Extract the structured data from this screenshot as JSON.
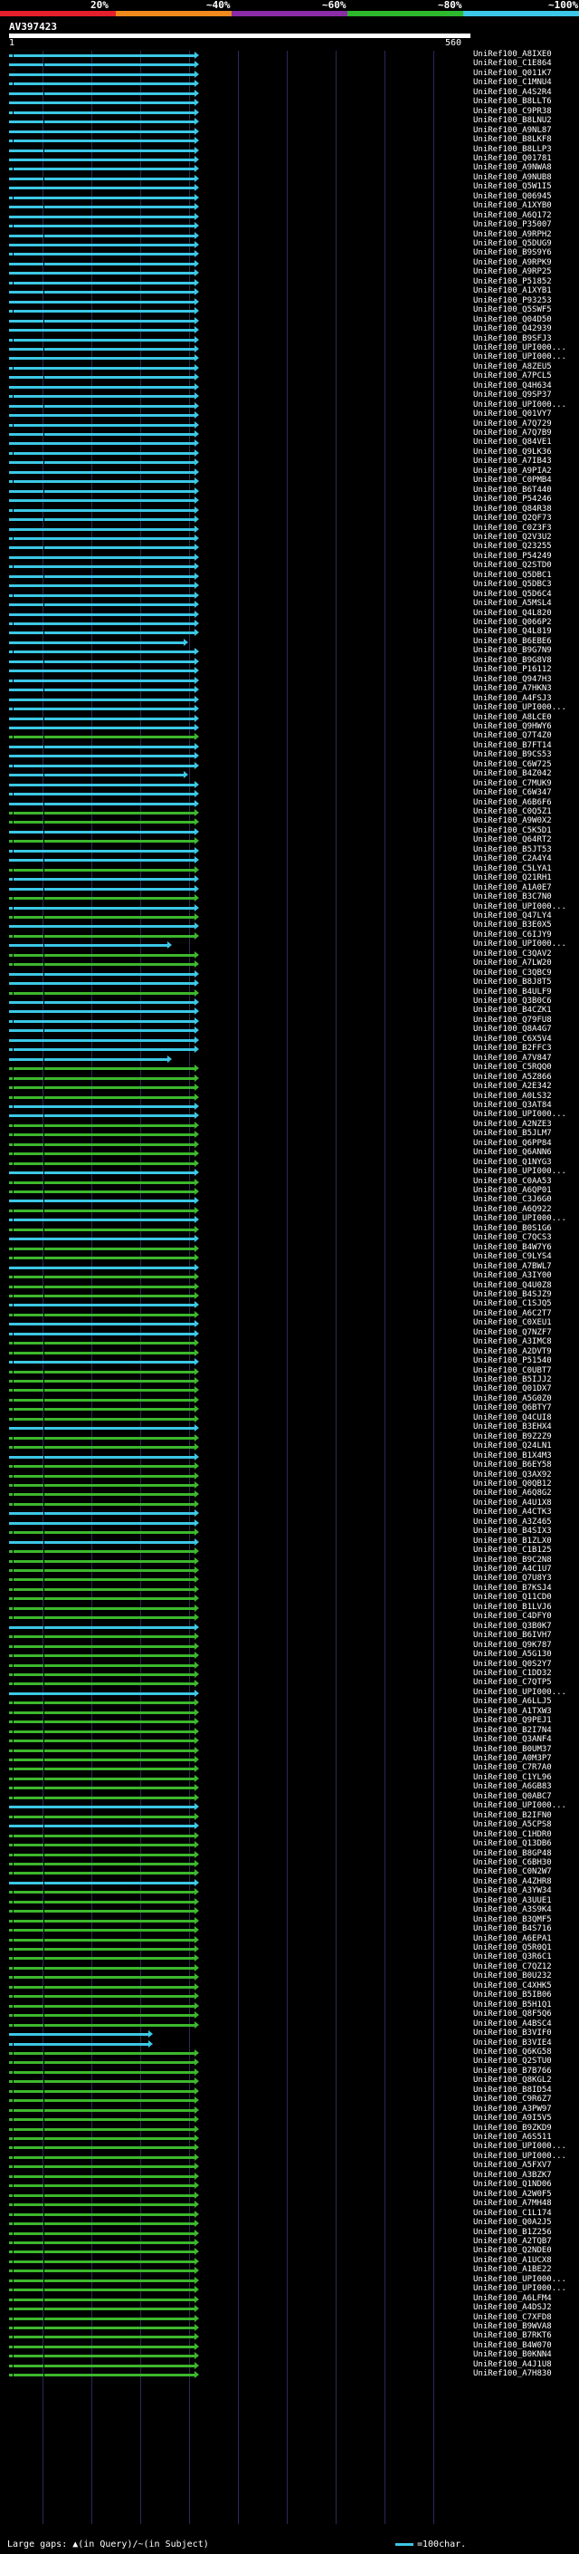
{
  "scale": {
    "ticks": [
      "20%",
      "~40%",
      "~60%",
      "~80%",
      "~100%"
    ],
    "colors": [
      "#e6202a",
      "#f08a1c",
      "#8a2ca6",
      "#2db82d",
      "#3cc8e6"
    ]
  },
  "query": {
    "name": "AV397423",
    "start": "1",
    "end": "560"
  },
  "hit_colors": {
    "cyan": "#3cc8e6",
    "green": "#3db82d",
    "gap": "#000000"
  },
  "hits": [
    {
      "label": "UniRef100_A8IXE0",
      "color": "cyan"
    },
    {
      "label": "UniRef100_C1E864",
      "color": "cyan"
    },
    {
      "label": "UniRef100_Q011K7",
      "color": "cyan"
    },
    {
      "label": "UniRef100_C1MNU4",
      "color": "cyan"
    },
    {
      "label": "UniRef100_A4S2R4",
      "color": "cyan"
    },
    {
      "label": "UniRef100_B8LLT6",
      "color": "cyan"
    },
    {
      "label": "UniRef100_C9PR38",
      "color": "cyan"
    },
    {
      "label": "UniRef100_B8LNU2",
      "color": "cyan"
    },
    {
      "label": "UniRef100_A9NL87",
      "color": "cyan"
    },
    {
      "label": "UniRef100_B8LKF8",
      "color": "cyan"
    },
    {
      "label": "UniRef100_B8LLP3",
      "color": "cyan"
    },
    {
      "label": "UniRef100_Q01781",
      "color": "cyan"
    },
    {
      "label": "UniRef100_A9NWA8",
      "color": "cyan"
    },
    {
      "label": "UniRef100_A9NUB8",
      "color": "cyan"
    },
    {
      "label": "UniRef100_Q5W1I5",
      "color": "cyan"
    },
    {
      "label": "UniRef100_Q06945",
      "color": "cyan"
    },
    {
      "label": "UniRef100_A1XYB0",
      "color": "cyan"
    },
    {
      "label": "UniRef100_A6Q172",
      "color": "cyan"
    },
    {
      "label": "UniRef100_P35007",
      "color": "cyan"
    },
    {
      "label": "UniRef100_A9RPH2",
      "color": "cyan"
    },
    {
      "label": "UniRef100_Q5DUG9",
      "color": "cyan"
    },
    {
      "label": "UniRef100_B9S9Y6",
      "color": "cyan"
    },
    {
      "label": "UniRef100_A9RPK9",
      "color": "cyan"
    },
    {
      "label": "UniRef100_A9RP25",
      "color": "cyan"
    },
    {
      "label": "UniRef100_P51852",
      "color": "cyan"
    },
    {
      "label": "UniRef100_A1XYB1",
      "color": "cyan"
    },
    {
      "label": "UniRef100_P93253",
      "color": "cyan"
    },
    {
      "label": "UniRef100_Q5SWF5",
      "color": "cyan"
    },
    {
      "label": "UniRef100_Q04D50",
      "color": "cyan"
    },
    {
      "label": "UniRef100_Q42939",
      "color": "cyan"
    },
    {
      "label": "UniRef100_B9SFJ3",
      "color": "cyan"
    },
    {
      "label": "UniRef100_UPI000...",
      "color": "cyan"
    },
    {
      "label": "UniRef100_UPI000...",
      "color": "cyan"
    },
    {
      "label": "UniRef100_A8ZEU5",
      "color": "cyan"
    },
    {
      "label": "UniRef100_A7PCL5",
      "color": "cyan"
    },
    {
      "label": "UniRef100_Q4H634",
      "color": "cyan"
    },
    {
      "label": "UniRef100_Q9SP37",
      "color": "cyan"
    },
    {
      "label": "UniRef100_UPI000...",
      "color": "cyan"
    },
    {
      "label": "UniRef100_Q01VY7",
      "color": "cyan"
    },
    {
      "label": "UniRef100_A7Q729",
      "color": "cyan"
    },
    {
      "label": "UniRef100_A7Q7B9",
      "color": "cyan"
    },
    {
      "label": "UniRef100_Q84VE1",
      "color": "cyan"
    },
    {
      "label": "UniRef100_Q9LK36",
      "color": "cyan"
    },
    {
      "label": "UniRef100_A7IB43",
      "color": "cyan"
    },
    {
      "label": "UniRef100_A9PIA2",
      "color": "cyan"
    },
    {
      "label": "UniRef100_C0PMB4",
      "color": "cyan"
    },
    {
      "label": "UniRef100_B6T440",
      "color": "cyan"
    },
    {
      "label": "UniRef100_P54246",
      "color": "cyan"
    },
    {
      "label": "UniRef100_Q84R38",
      "color": "cyan"
    },
    {
      "label": "UniRef100_Q2QF73",
      "color": "cyan"
    },
    {
      "label": "UniRef100_C0Z3F3",
      "color": "cyan"
    },
    {
      "label": "UniRef100_Q2V3U2",
      "color": "cyan"
    },
    {
      "label": "UniRef100_Q23255",
      "color": "cyan"
    },
    {
      "label": "UniRef100_P54249",
      "color": "cyan"
    },
    {
      "label": "UniRef100_Q2STD0",
      "color": "cyan"
    },
    {
      "label": "UniRef100_Q5DBC1",
      "color": "cyan"
    },
    {
      "label": "UniRef100_Q5DBC3",
      "color": "cyan"
    },
    {
      "label": "UniRef100_Q5D6C4",
      "color": "cyan"
    },
    {
      "label": "UniRef100_A5MSL4",
      "color": "cyan"
    },
    {
      "label": "UniRef100_Q4L820",
      "color": "cyan"
    },
    {
      "label": "UniRef100_Q066P2",
      "color": "cyan"
    },
    {
      "label": "UniRef100_Q4L819",
      "color": "cyan"
    },
    {
      "label": "UniRef100_B6EBE6",
      "color": "cyan",
      "short": true
    },
    {
      "label": "UniRef100_B9G7N9",
      "color": "cyan"
    },
    {
      "label": "UniRef100_B9G8V8",
      "color": "cyan"
    },
    {
      "label": "UniRef100_P16112",
      "color": "cyan"
    },
    {
      "label": "UniRef100_Q947H3",
      "color": "cyan"
    },
    {
      "label": "UniRef100_A7HKN3",
      "color": "cyan"
    },
    {
      "label": "UniRef100_A4FSJ3",
      "color": "cyan"
    },
    {
      "label": "UniRef100_UPI000...",
      "color": "cyan"
    },
    {
      "label": "UniRef100_A8LCE0",
      "color": "cyan"
    },
    {
      "label": "UniRef100_Q9HWY6",
      "color": "cyan"
    },
    {
      "label": "UniRef100_Q7T4Z0",
      "color": "green"
    },
    {
      "label": "UniRef100_B7FT14",
      "color": "cyan"
    },
    {
      "label": "UniRef100_B9CS53",
      "color": "cyan"
    },
    {
      "label": "UniRef100_C6W725",
      "color": "cyan"
    },
    {
      "label": "UniRef100_B4Z042",
      "color": "cyan",
      "short": true
    },
    {
      "label": "UniRef100_C7MUK9",
      "color": "cyan"
    },
    {
      "label": "UniRef100_C6W347",
      "color": "cyan"
    },
    {
      "label": "UniRef100_A6B6F6",
      "color": "cyan"
    },
    {
      "label": "UniRef100_C0Q5Z1",
      "color": "green"
    },
    {
      "label": "UniRef100_A9W0X2",
      "color": "green"
    },
    {
      "label": "UniRef100_C5K5D1",
      "color": "cyan"
    },
    {
      "label": "UniRef100_Q64RT2",
      "color": "green"
    },
    {
      "label": "UniRef100_B5JT53",
      "color": "cyan"
    },
    {
      "label": "UniRef100_C2A4Y4",
      "color": "cyan"
    },
    {
      "label": "UniRef100_C5LYA1",
      "color": "green"
    },
    {
      "label": "UniRef100_Q21RH1",
      "color": "cyan"
    },
    {
      "label": "UniRef100_A1A0E7",
      "color": "cyan"
    },
    {
      "label": "UniRef100_B3C7N0",
      "color": "green"
    },
    {
      "label": "UniRef100_UPI000...",
      "color": "cyan"
    },
    {
      "label": "UniRef100_Q47LY4",
      "color": "green"
    },
    {
      "label": "UniRef100_B3E0X5",
      "color": "cyan"
    },
    {
      "label": "UniRef100_C6IJY9",
      "color": "green"
    },
    {
      "label": "UniRef100_UPI000...",
      "color": "cyan",
      "short2": true
    },
    {
      "label": "UniRef100_C3QAV2",
      "color": "green"
    },
    {
      "label": "UniRef100_A7LW20",
      "color": "green"
    },
    {
      "label": "UniRef100_C3QBC9",
      "color": "cyan"
    },
    {
      "label": "UniRef100_B8J8T5",
      "color": "cyan"
    },
    {
      "label": "UniRef100_B4ULF9",
      "color": "green"
    },
    {
      "label": "UniRef100_Q3B0C6",
      "color": "cyan"
    },
    {
      "label": "UniRef100_B4CZK1",
      "color": "cyan"
    },
    {
      "label": "UniRef100_Q79FU8",
      "color": "cyan"
    },
    {
      "label": "UniRef100_Q8A4G7",
      "color": "cyan"
    },
    {
      "label": "UniRef100_C6X5V4",
      "color": "cyan"
    },
    {
      "label": "UniRef100_B2FFC3",
      "color": "cyan"
    },
    {
      "label": "UniRef100_A7V847",
      "color": "cyan",
      "short2": true
    },
    {
      "label": "UniRef100_C5RQQ0",
      "color": "green"
    },
    {
      "label": "UniRef100_A5Z866",
      "color": "green"
    },
    {
      "label": "UniRef100_A2E342",
      "color": "green"
    },
    {
      "label": "UniRef100_A0LS32",
      "color": "green"
    },
    {
      "label": "UniRef100_Q3AT84",
      "color": "cyan"
    },
    {
      "label": "UniRef100_UPI000...",
      "color": "cyan"
    },
    {
      "label": "UniRef100_A2NZE3",
      "color": "green"
    },
    {
      "label": "UniRef100_B5JLM7",
      "color": "green"
    },
    {
      "label": "UniRef100_Q6PP84",
      "color": "green"
    },
    {
      "label": "UniRef100_Q6ANN6",
      "color": "green"
    },
    {
      "label": "UniRef100_Q1NYG3",
      "color": "green"
    },
    {
      "label": "UniRef100_UPI000...",
      "color": "cyan"
    },
    {
      "label": "UniRef100_C0AA53",
      "color": "green"
    },
    {
      "label": "UniRef100_A6QP01",
      "color": "green"
    },
    {
      "label": "UniRef100_C3J6G0",
      "color": "cyan"
    },
    {
      "label": "UniRef100_A6Q922",
      "color": "green"
    },
    {
      "label": "UniRef100_UPI000...",
      "color": "cyan"
    },
    {
      "label": "UniRef100_B0S1G6",
      "color": "green"
    },
    {
      "label": "UniRef100_C7QCS3",
      "color": "cyan"
    },
    {
      "label": "UniRef100_B4W7Y6",
      "color": "green"
    },
    {
      "label": "UniRef100_C9LYS4",
      "color": "green"
    },
    {
      "label": "UniRef100_A7BWL7",
      "color": "cyan"
    },
    {
      "label": "UniRef100_A3IY00",
      "color": "green"
    },
    {
      "label": "UniRef100_Q4U0Z8",
      "color": "green"
    },
    {
      "label": "UniRef100_B4SJZ9",
      "color": "green"
    },
    {
      "label": "UniRef100_C1SJQ5",
      "color": "cyan"
    },
    {
      "label": "UniRef100_A6C2T7",
      "color": "green"
    },
    {
      "label": "UniRef100_C0XEU1",
      "color": "cyan"
    },
    {
      "label": "UniRef100_Q7NZF7",
      "color": "cyan"
    },
    {
      "label": "UniRef100_A3IMC8",
      "color": "green"
    },
    {
      "label": "UniRef100_A2DVT9",
      "color": "green"
    },
    {
      "label": "UniRef100_P51540",
      "color": "cyan"
    },
    {
      "label": "UniRef100_C0UBT7",
      "color": "green"
    },
    {
      "label": "UniRef100_B5IJJ2",
      "color": "green"
    },
    {
      "label": "UniRef100_Q01DX7",
      "color": "green"
    },
    {
      "label": "UniRef100_A5G0Z0",
      "color": "green"
    },
    {
      "label": "UniRef100_Q6BTY7",
      "color": "green"
    },
    {
      "label": "UniRef100_Q4CUI8",
      "color": "green"
    },
    {
      "label": "UniRef100_B3EHX4",
      "color": "cyan"
    },
    {
      "label": "UniRef100_B9Z2Z9",
      "color": "green"
    },
    {
      "label": "UniRef100_Q24LN1",
      "color": "green"
    },
    {
      "label": "UniRef100_B1X4M3",
      "color": "cyan"
    },
    {
      "label": "UniRef100_B6EY58",
      "color": "green"
    },
    {
      "label": "UniRef100_Q3AX92",
      "color": "green"
    },
    {
      "label": "UniRef100_Q0QB12",
      "color": "green"
    },
    {
      "label": "UniRef100_A6Q8G2",
      "color": "green"
    },
    {
      "label": "UniRef100_A4U1X8",
      "color": "green"
    },
    {
      "label": "UniRef100_A4CTK3",
      "color": "cyan"
    },
    {
      "label": "UniRef100_A3Z465",
      "color": "cyan"
    },
    {
      "label": "UniRef100_B4SIX3",
      "color": "green"
    },
    {
      "label": "UniRef100_B1ZLX0",
      "color": "cyan"
    },
    {
      "label": "UniRef100_C1B125",
      "color": "green"
    },
    {
      "label": "UniRef100_B9C2N8",
      "color": "green"
    },
    {
      "label": "UniRef100_A4C1U7",
      "color": "green"
    },
    {
      "label": "UniRef100_Q7U8Y3",
      "color": "green"
    },
    {
      "label": "UniRef100_B7KSJ4",
      "color": "green"
    },
    {
      "label": "UniRef100_Q11CD0",
      "color": "green"
    },
    {
      "label": "UniRef100_B1LVJ6",
      "color": "green"
    },
    {
      "label": "UniRef100_C4DFY0",
      "color": "green"
    },
    {
      "label": "UniRef100_Q3B0K7",
      "color": "cyan"
    },
    {
      "label": "UniRef100_B6IVH7",
      "color": "green"
    },
    {
      "label": "UniRef100_Q9K787",
      "color": "green"
    },
    {
      "label": "UniRef100_A5G130",
      "color": "green"
    },
    {
      "label": "UniRef100_Q0S2Y7",
      "color": "green"
    },
    {
      "label": "UniRef100_C1DD32",
      "color": "green"
    },
    {
      "label": "UniRef100_C7QTP5",
      "color": "green"
    },
    {
      "label": "UniRef100_UPI000...",
      "color": "cyan"
    },
    {
      "label": "UniRef100_A6LLJ5",
      "color": "green"
    },
    {
      "label": "UniRef100_A1TXW3",
      "color": "green"
    },
    {
      "label": "UniRef100_Q9PEJ1",
      "color": "green"
    },
    {
      "label": "UniRef100_B2I7N4",
      "color": "green"
    },
    {
      "label": "UniRef100_Q3ANF4",
      "color": "green"
    },
    {
      "label": "UniRef100_B0UM37",
      "color": "green"
    },
    {
      "label": "UniRef100_A0M3P7",
      "color": "green"
    },
    {
      "label": "UniRef100_C7R7A0",
      "color": "green"
    },
    {
      "label": "UniRef100_C1YL96",
      "color": "green"
    },
    {
      "label": "UniRef100_A6GB83",
      "color": "green"
    },
    {
      "label": "UniRef100_Q0ABC7",
      "color": "green"
    },
    {
      "label": "UniRef100_UPI000...",
      "color": "cyan"
    },
    {
      "label": "UniRef100_B2IFN0",
      "color": "green"
    },
    {
      "label": "UniRef100_A5CPS8",
      "color": "cyan"
    },
    {
      "label": "UniRef100_C1HDR0",
      "color": "green"
    },
    {
      "label": "UniRef100_Q13DB6",
      "color": "green"
    },
    {
      "label": "UniRef100_B8GP48",
      "color": "green"
    },
    {
      "label": "UniRef100_C6BH30",
      "color": "green"
    },
    {
      "label": "UniRef100_C0N2W7",
      "color": "green"
    },
    {
      "label": "UniRef100_A4ZHR8",
      "color": "cyan"
    },
    {
      "label": "UniRef100_A3YW34",
      "color": "green"
    },
    {
      "label": "UniRef100_A3UUE1",
      "color": "green"
    },
    {
      "label": "UniRef100_A3S9K4",
      "color": "green"
    },
    {
      "label": "UniRef100_B3QMF5",
      "color": "green"
    },
    {
      "label": "UniRef100_B4S716",
      "color": "green"
    },
    {
      "label": "UniRef100_A6EPA1",
      "color": "green"
    },
    {
      "label": "UniRef100_Q5R0Q1",
      "color": "green"
    },
    {
      "label": "UniRef100_Q3R6C1",
      "color": "green"
    },
    {
      "label": "UniRef100_C7QZ12",
      "color": "green"
    },
    {
      "label": "UniRef100_B0U232",
      "color": "green"
    },
    {
      "label": "UniRef100_C4XHK5",
      "color": "green"
    },
    {
      "label": "UniRef100_B5IB06",
      "color": "green"
    },
    {
      "label": "UniRef100_B5H1Q1",
      "color": "green"
    },
    {
      "label": "UniRef100_Q8F5Q6",
      "color": "green"
    },
    {
      "label": "UniRef100_A4BSC4",
      "color": "green"
    },
    {
      "label": "UniRef100_B3VIF0",
      "color": "cyan",
      "short3": true
    },
    {
      "label": "UniRef100_B3VIE4",
      "color": "cyan",
      "short3": true
    },
    {
      "label": "UniRef100_Q6KG58",
      "color": "green"
    },
    {
      "label": "UniRef100_Q2STU0",
      "color": "green"
    },
    {
      "label": "UniRef100_B7B766",
      "color": "green"
    },
    {
      "label": "UniRef100_Q8KGL2",
      "color": "green"
    },
    {
      "label": "UniRef100_B8ID54",
      "color": "green"
    },
    {
      "label": "UniRef100_C9R6Z7",
      "color": "green"
    },
    {
      "label": "UniRef100_A3PW97",
      "color": "green"
    },
    {
      "label": "UniRef100_A9I5V5",
      "color": "green"
    },
    {
      "label": "UniRef100_B9ZKD9",
      "color": "green"
    },
    {
      "label": "UniRef100_A6S511",
      "color": "green"
    },
    {
      "label": "UniRef100_UPI000...",
      "color": "green"
    },
    {
      "label": "UniRef100_UPI000...",
      "color": "green"
    },
    {
      "label": "UniRef100_A5FXV7",
      "color": "green"
    },
    {
      "label": "UniRef100_A3BZK7",
      "color": "green"
    },
    {
      "label": "UniRef100_Q1ND06",
      "color": "green"
    },
    {
      "label": "UniRef100_A2W0F5",
      "color": "green"
    },
    {
      "label": "UniRef100_A7MH48",
      "color": "green"
    },
    {
      "label": "UniRef100_C1L174",
      "color": "green"
    },
    {
      "label": "UniRef100_Q0A2J5",
      "color": "green"
    },
    {
      "label": "UniRef100_B1Z256",
      "color": "green"
    },
    {
      "label": "UniRef100_A2TQB7",
      "color": "green"
    },
    {
      "label": "UniRef100_Q2NDE0",
      "color": "green"
    },
    {
      "label": "UniRef100_A1UCX8",
      "color": "green"
    },
    {
      "label": "UniRef100_A1BE22",
      "color": "green"
    },
    {
      "label": "UniRef100_UPI000...",
      "color": "green"
    },
    {
      "label": "UniRef100_UPI000...",
      "color": "green"
    },
    {
      "label": "UniRef100_A6LFM4",
      "color": "green"
    },
    {
      "label": "UniRef100_A4DSJ2",
      "color": "green"
    },
    {
      "label": "UniRef100_C7XFD8",
      "color": "green"
    },
    {
      "label": "UniRef100_B9WVA8",
      "color": "green"
    },
    {
      "label": "UniRef100_B7RKT6",
      "color": "green"
    },
    {
      "label": "UniRef100_B4W070",
      "color": "green"
    },
    {
      "label": "UniRef100_B0KNN4",
      "color": "green"
    },
    {
      "label": "UniRef100_A4J1U8",
      "color": "green"
    },
    {
      "label": "UniRef100_A7H830",
      "color": "green"
    }
  ],
  "legend": {
    "gaps": "Large gaps: ▲(in Query)/~(in Subject)",
    "scale_label": "=100char."
  }
}
